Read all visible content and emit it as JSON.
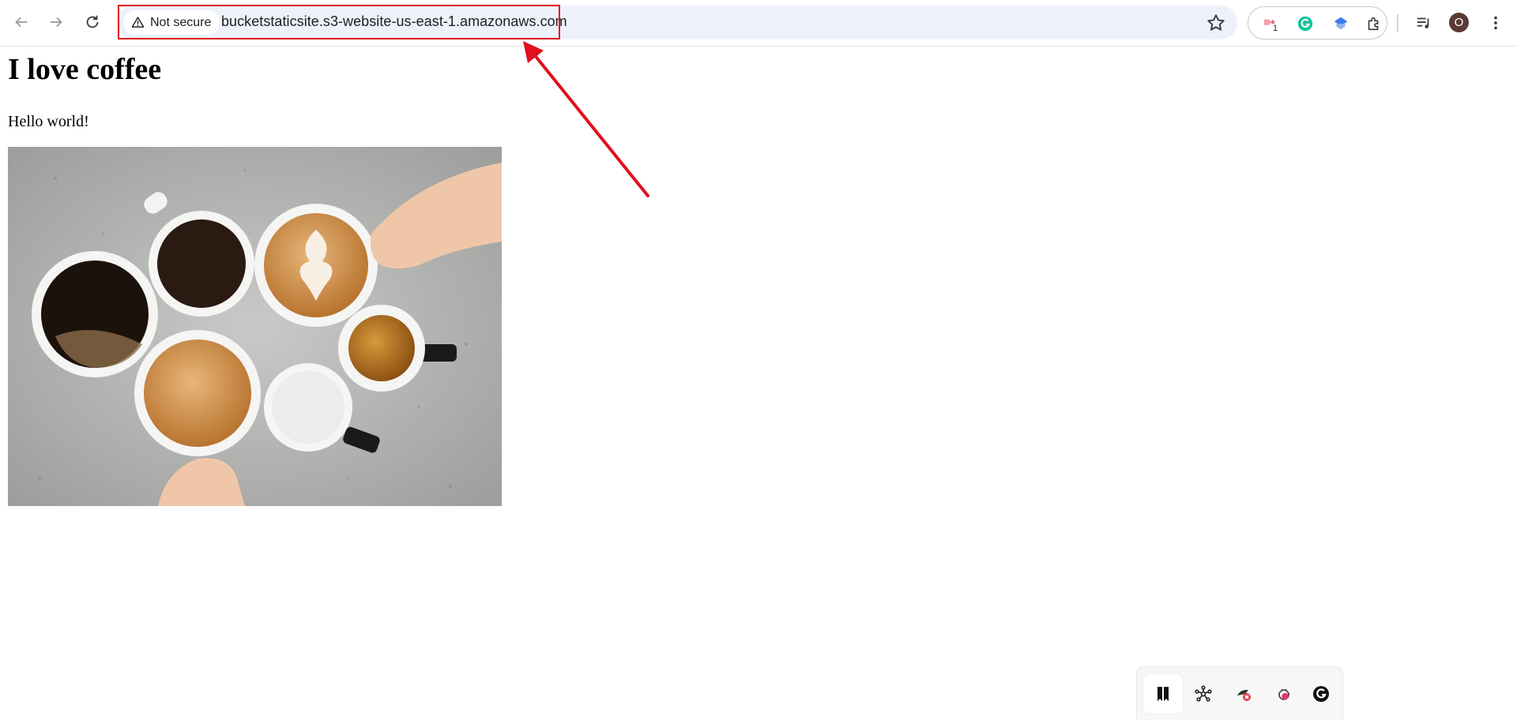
{
  "browser": {
    "security_label": "Not secure",
    "url": "bucketstaticsite.s3-website-us-east-1.amazonaws.com",
    "extension_badge": "1",
    "profile_initial": "O"
  },
  "page": {
    "heading": "I love coffee",
    "text": "Hello world!"
  },
  "icons": {
    "back": "arrow-left",
    "forward": "arrow-right",
    "reload": "reload",
    "warning": "warning-triangle",
    "bookmark": "star",
    "extensions": [
      "ext-pin-icon",
      "grammarly-icon",
      "shield-cap-icon",
      "puzzle-icon"
    ],
    "media": "playlist-icon",
    "menu": "kebab-menu-icon",
    "floating_toolbar": [
      "bookmark-icon",
      "network-icon",
      "hacker-icon",
      "bug-icon",
      "grammarly-icon"
    ]
  },
  "colors": {
    "annotation": "#e0101e",
    "omnibox_bg": "#edf1fa",
    "grammarly": "#15c39a"
  }
}
